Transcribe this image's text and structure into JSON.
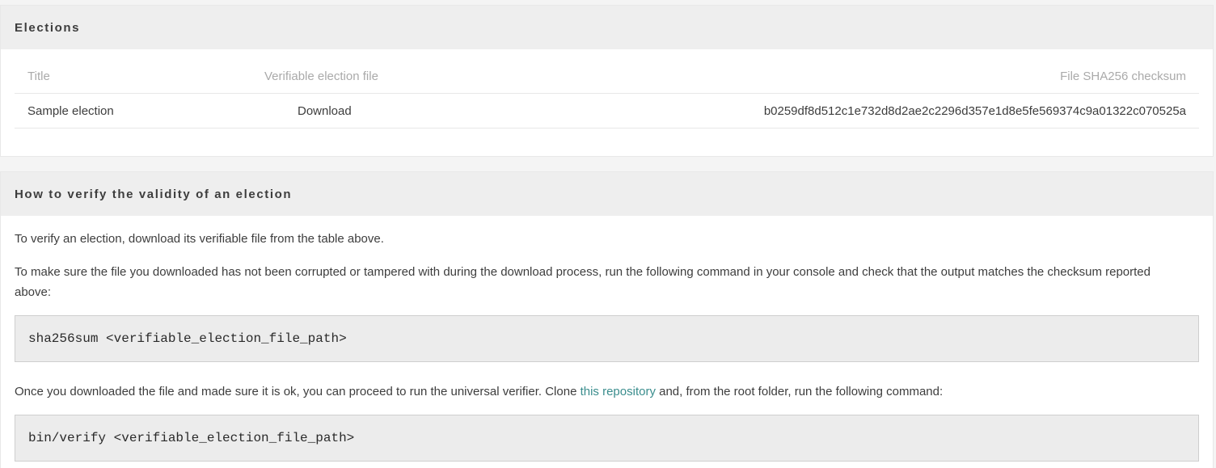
{
  "elections": {
    "header": "Elections",
    "columns": {
      "title": "Title",
      "file": "Verifiable election file",
      "checksum": "File SHA256 checksum"
    },
    "rows": [
      {
        "title": "Sample election",
        "file": "Download",
        "checksum": "b0259df8d512c1e732d8d2ae2c2296d357e1d8e5fe569374c9a01322c070525a"
      }
    ]
  },
  "verify": {
    "header": "How to verify the validity of an election",
    "p1": "To verify an election, download its verifiable file from the table above.",
    "p2": "To make sure the file you downloaded has not been corrupted or tampered with during the download process, run the following command in your console and check that the output matches the checksum reported above:",
    "code1": "sha256sum <verifiable_election_file_path>",
    "p3_before": "Once you downloaded the file and made sure it is ok, you can proceed to run the universal verifier. Clone ",
    "p3_link": "this repository",
    "p3_after": " and, from the root folder, run the following command:",
    "code2": "bin/verify <verifiable_election_file_path>"
  },
  "colors": {
    "header_bg": "#eeeeee",
    "link": "#3a8d8d",
    "code_bg": "#ececec"
  }
}
